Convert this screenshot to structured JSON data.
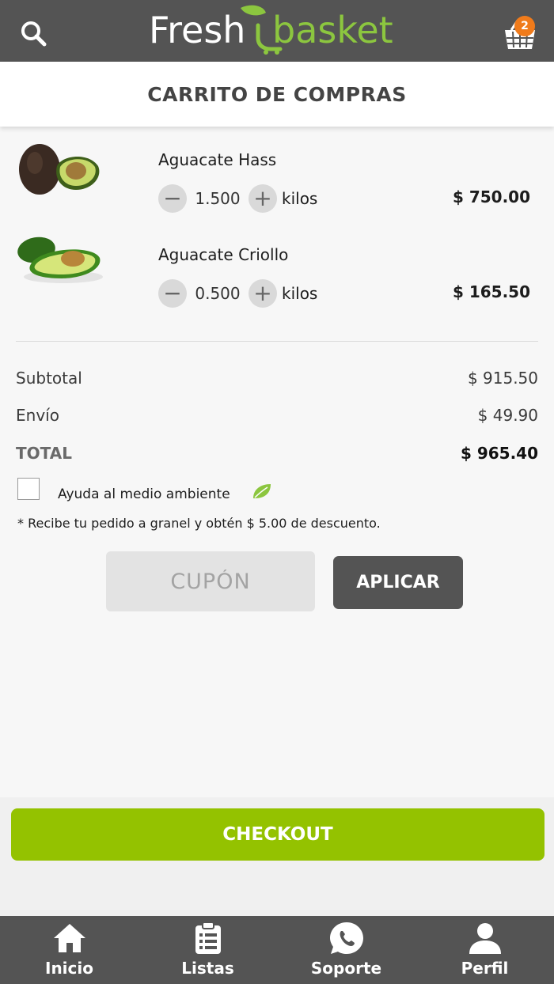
{
  "header": {
    "search_icon": "search-icon",
    "logo_text_left": "Fresh",
    "logo_text_right": "basket",
    "cart_icon": "shopping-basket-icon",
    "cart_count": "2",
    "colors": {
      "bar": "#545454",
      "logo_green": "#8cc63f",
      "badge": "#f07b1b"
    }
  },
  "page_title": "CARRITO DE COMPRAS",
  "cart": {
    "items": [
      {
        "name": "Aguacate Hass",
        "quantity": "1.500",
        "unit": "kilos",
        "price": "$ 750.00",
        "image": "avocado-hass-image"
      },
      {
        "name": "Aguacate Criollo",
        "quantity": "0.500",
        "unit": "kilos",
        "price": "$ 165.50",
        "image": "avocado-criollo-image"
      }
    ],
    "minus_symbol": "−",
    "plus_symbol": "+"
  },
  "summary": {
    "subtotal_label": "Subtotal",
    "subtotal_value": "$ 915.50",
    "shipping_label": "Envío",
    "shipping_value": "$ 49.90",
    "total_label": "TOTAL",
    "total_value": "$ 965.40"
  },
  "eco": {
    "checkbox_label": "Ayuda al medio ambiente",
    "icon": "leaf-icon",
    "note": "* Recibe tu pedido a granel y obtén $ 5.00 de descuento."
  },
  "coupon": {
    "placeholder": "CUPÓN",
    "apply_label": "APLICAR"
  },
  "checkout_label": "CHECKOUT",
  "checkout_color": "#94c200",
  "tabs": [
    {
      "label": "Inicio",
      "icon": "home-icon"
    },
    {
      "label": "Listas",
      "icon": "clipboard-list-icon"
    },
    {
      "label": "Soporte",
      "icon": "whatsapp-icon"
    },
    {
      "label": "Perfil",
      "icon": "user-icon"
    }
  ]
}
